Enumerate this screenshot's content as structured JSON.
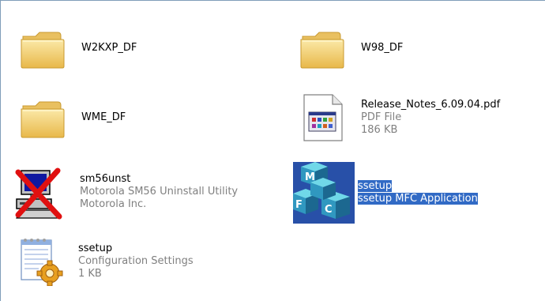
{
  "items": [
    {
      "name": "W2KXP_DF",
      "icon": "folder-icon"
    },
    {
      "name": "W98_DF",
      "icon": "folder-icon"
    },
    {
      "name": "WME_DF",
      "icon": "folder-icon"
    },
    {
      "name": "Release_Notes_6.09.04.pdf",
      "line2": "PDF File",
      "line3": "186 KB",
      "icon": "pdf-document-icon"
    },
    {
      "name": "sm56unst",
      "line2": "Motorola SM56 Uninstall Utility",
      "line3": "Motorola Inc.",
      "icon": "uninstall-computer-red-x-icon"
    },
    {
      "name": "ssetup",
      "line2": "ssetup MFC Application",
      "icon": "mfc-application-blocks-icon",
      "selected": true
    },
    {
      "name": "ssetup",
      "line2": "Configuration Settings",
      "line3": "1 KB",
      "icon": "configuration-settings-file-icon"
    }
  ],
  "colors": {
    "selection": "#316ac5",
    "folder": "#f5d57a",
    "secondary_text": "#808080"
  }
}
